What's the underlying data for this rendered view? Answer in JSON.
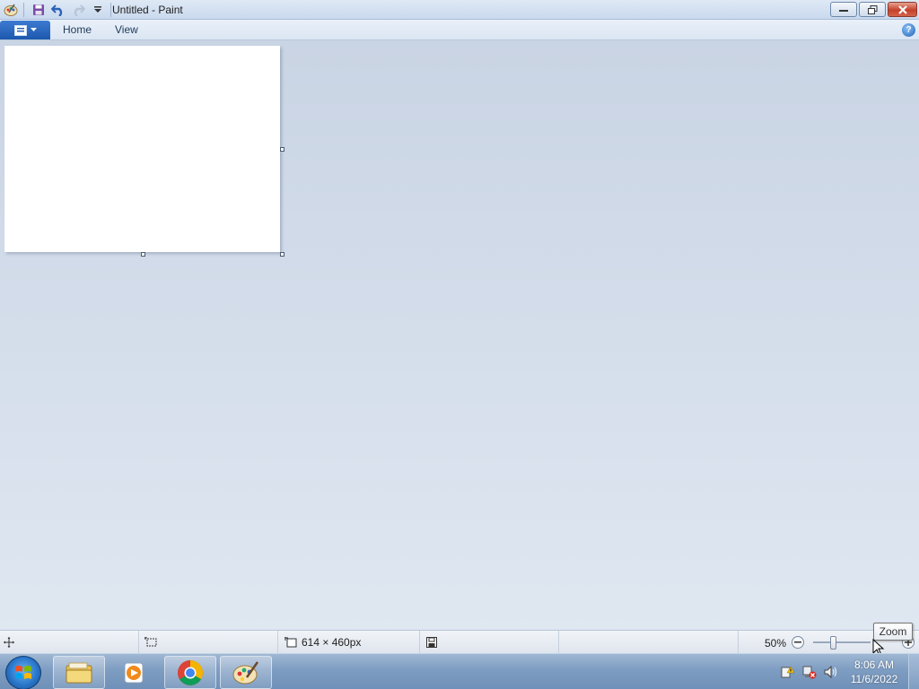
{
  "window": {
    "title": "Untitled - Paint"
  },
  "quick_access": {
    "icons": [
      "paint-app-icon",
      "save-icon",
      "undo-icon",
      "redo-icon",
      "customize-dropdown-icon"
    ]
  },
  "ribbon": {
    "tabs": [
      {
        "label": "Home"
      },
      {
        "label": "View"
      }
    ],
    "help_glyph": "?"
  },
  "statusbar": {
    "canvas_size": "614 × 460px",
    "zoom": {
      "label": "50%",
      "level_percent": 50
    },
    "tooltip": "Zoom"
  },
  "taskbar": {
    "apps": [
      "windows-explorer-icon",
      "media-player-icon",
      "chrome-icon",
      "paint-icon"
    ],
    "tray_icons": [
      "action-center-icon",
      "network-icon",
      "volume-icon"
    ],
    "clock": {
      "time": "8:06 AM",
      "date": "11/6/2022"
    }
  },
  "colors": {
    "accent": "#1c58ad",
    "workspace_top": "#c9d4e4",
    "workspace_bottom": "#dfe7f1",
    "close_button": "#c5402a"
  }
}
